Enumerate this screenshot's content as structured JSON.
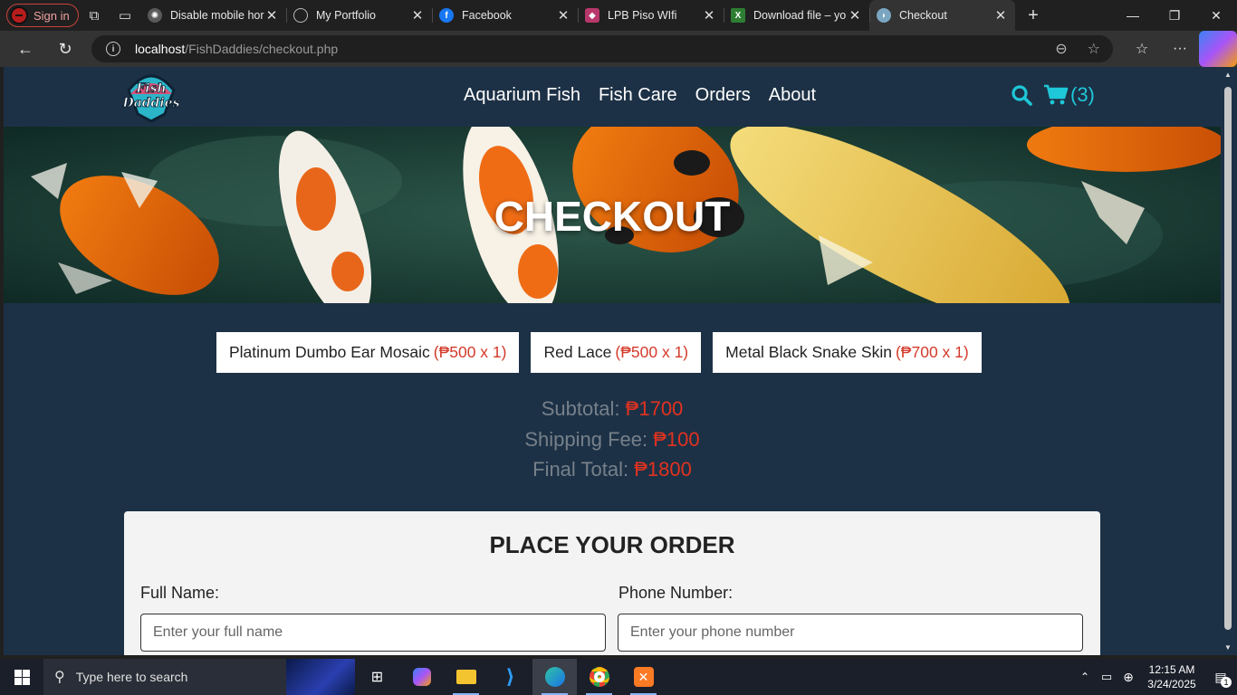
{
  "browser": {
    "signin_label": "Sign in",
    "tabs": [
      {
        "title": "Disable mobile hor",
        "icon": "openai-icon",
        "color": "#6b6b6b"
      },
      {
        "title": "My Portfolio",
        "icon": "globe-icon",
        "color": "#4a4a4a"
      },
      {
        "title": "Facebook",
        "icon": "facebook-icon",
        "color": "#1877f2"
      },
      {
        "title": "LPB Piso WIfi",
        "icon": "wifi-icon",
        "color": "#b8386b"
      },
      {
        "title": "Download file – yo",
        "icon": "download-icon",
        "color": "#2e7d32"
      },
      {
        "title": "Checkout",
        "icon": "fish-icon",
        "color": "#7aa6c2",
        "active": true
      }
    ],
    "address": {
      "host": "localhost",
      "path": "/FishDaddies/checkout.php"
    }
  },
  "site": {
    "logo_text": [
      "Fish",
      "Daddies"
    ],
    "nav": [
      "Aquarium Fish",
      "Fish Care",
      "Orders",
      "About"
    ],
    "cart_count": "(3)",
    "hero_title": "CHECKOUT"
  },
  "cart_items": [
    {
      "name": "Platinum Dumbo Ear Mosaic",
      "price": "(₱500 x 1)"
    },
    {
      "name": "Red Lace",
      "price": "(₱500 x 1)"
    },
    {
      "name": "Metal Black Snake Skin",
      "price": "(₱700 x 1)"
    }
  ],
  "totals": {
    "subtotal_label": "Subtotal:",
    "subtotal": "₱1700",
    "shipping_label": "Shipping Fee:",
    "shipping": "₱100",
    "final_label": "Final Total:",
    "final": "₱1800"
  },
  "order_form": {
    "title": "PLACE YOUR ORDER",
    "full_name_label": "Full Name:",
    "full_name_placeholder": "Enter your full name",
    "phone_label": "Phone Number:",
    "phone_placeholder": "Enter your phone number"
  },
  "taskbar": {
    "search_placeholder": "Type here to search",
    "time": "12:15 AM",
    "date": "3/24/2025",
    "notification_count": "1"
  },
  "colors": {
    "accent": "#1ec8d8",
    "price_red": "#e0321f",
    "page_bg": "#1d3146"
  }
}
